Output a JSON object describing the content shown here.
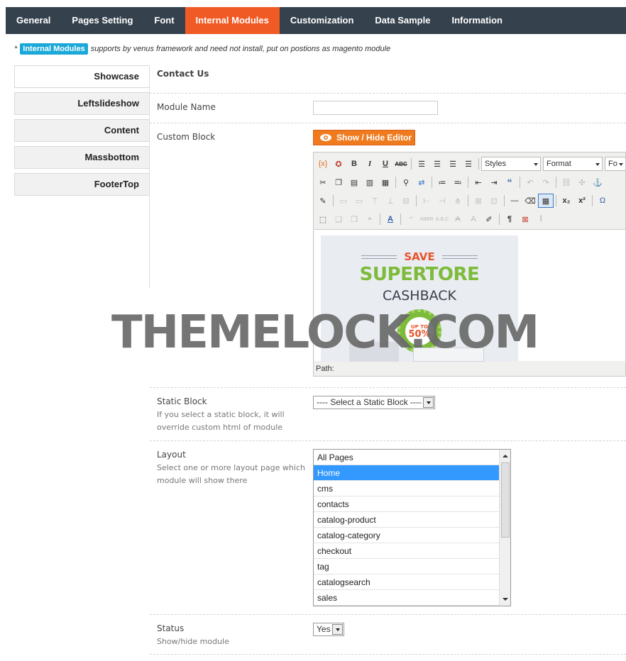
{
  "nav": {
    "tabs": [
      "General",
      "Pages Setting",
      "Font",
      "Internal Modules",
      "Customization",
      "Data Sample",
      "Information"
    ],
    "active": 3
  },
  "note": {
    "star": "*",
    "badge": "Internal Modules",
    "text": "supports by venus framework and need not install, put on postions as magento module"
  },
  "sidebar": {
    "items": [
      "Showcase",
      "Leftslideshow",
      "Content",
      "Massbottom",
      "FooterTop"
    ]
  },
  "form": {
    "section_title": "Contact Us",
    "module_name_label": "Module Name",
    "module_name_value": "",
    "custom_block_label": "Custom Block",
    "show_hide_button": "Show / Hide Editor",
    "editor": {
      "styles_select": "Styles",
      "format_select": "Format",
      "font_select": "Fo",
      "path_label": "Path:",
      "banner": {
        "save": "SAVE",
        "line1": "SUPERTORE",
        "line2": "CASHBACK",
        "badge_top": "UP TO",
        "badge_value": "50%"
      }
    },
    "static_block_label": "Static Block",
    "static_block_hint": "If you select a static block, it will override custom html of module",
    "static_block_value": "---- Select a Static Block ----",
    "layout_label": "Layout",
    "layout_hint": "Select one or more layout page which module will show there",
    "layout_options": [
      "All Pages",
      "Home",
      "cms",
      "contacts",
      "catalog-product",
      "catalog-category",
      "checkout",
      "tag",
      "catalogsearch",
      "sales"
    ],
    "layout_selected": "Home",
    "status_label": "Status",
    "status_hint": "Show/hide module",
    "status_value": "Yes"
  },
  "watermark": "THEMELOCK.COM",
  "colors": {
    "nav_bg": "#35424e",
    "active_tab": "#f05a24",
    "badge": "#1aa8d8",
    "button": "#f07a1e",
    "selected": "#3399ff"
  }
}
